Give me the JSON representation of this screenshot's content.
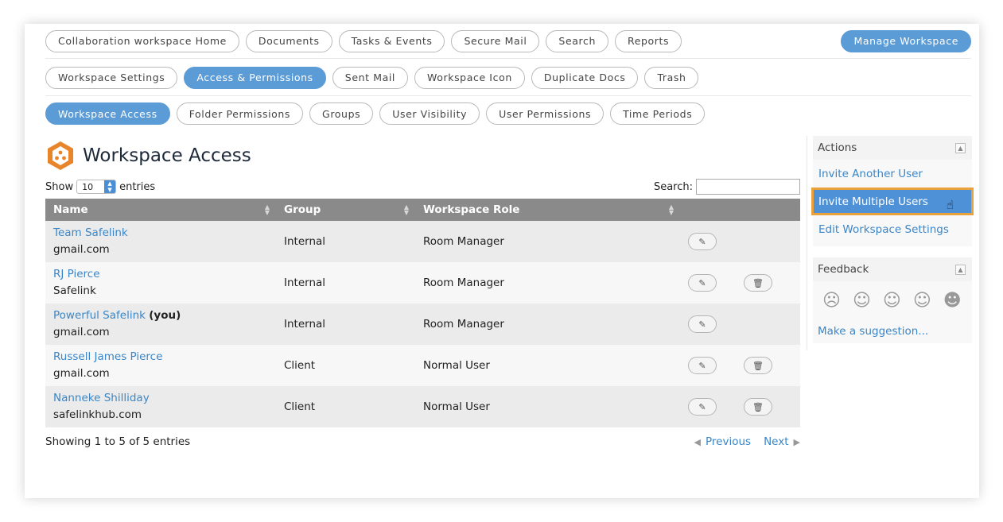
{
  "nav_primary": [
    "Collaboration workspace Home",
    "Documents",
    "Tasks & Events",
    "Secure Mail",
    "Search",
    "Reports"
  ],
  "manage_label": "Manage Workspace",
  "nav_secondary": [
    "Workspace Settings",
    "Access & Permissions",
    "Sent Mail",
    "Workspace Icon",
    "Duplicate Docs",
    "Trash"
  ],
  "nav_tertiary": [
    "Workspace Access",
    "Folder Permissions",
    "Groups",
    "User Visibility",
    "User Permissions",
    "Time Periods"
  ],
  "page_title": "Workspace Access",
  "controls": {
    "show_label": "Show",
    "entries_value": "10",
    "entries_label": "entries",
    "search_label": "Search:"
  },
  "table": {
    "headers": [
      "Name",
      "Group",
      "Workspace Role"
    ],
    "rows": [
      {
        "name": "Team Safelink",
        "you": "",
        "sub": "gmail.com",
        "group": "Internal",
        "role": "Room Manager",
        "deletable": false
      },
      {
        "name": "RJ Pierce",
        "you": "",
        "sub": "Safelink",
        "group": "Internal",
        "role": "Room Manager",
        "deletable": true
      },
      {
        "name": "Powerful Safelink",
        "you": "(you)",
        "sub": "gmail.com",
        "group": "Internal",
        "role": "Room Manager",
        "deletable": false
      },
      {
        "name": "Russell James Pierce",
        "you": "",
        "sub": "gmail.com",
        "group": "Client",
        "role": "Normal User",
        "deletable": true
      },
      {
        "name": "Nanneke Shilliday",
        "you": "",
        "sub": "safelinkhub.com",
        "group": "Client",
        "role": "Normal User",
        "deletable": true
      }
    ]
  },
  "footer": {
    "info": "Showing 1 to 5 of 5 entries",
    "previous": "Previous",
    "next": "Next"
  },
  "sidebar": {
    "actions_title": "Actions",
    "actions": [
      "Invite Another User",
      "Invite Multiple Users",
      "Edit Workspace Settings"
    ],
    "feedback_title": "Feedback",
    "suggestion": "Make a suggestion..."
  },
  "colors": {
    "accent": "#5b9bd6",
    "link": "#3a86c8",
    "highlight_border": "#e9a23b",
    "header_bg": "#8a8a8a"
  }
}
